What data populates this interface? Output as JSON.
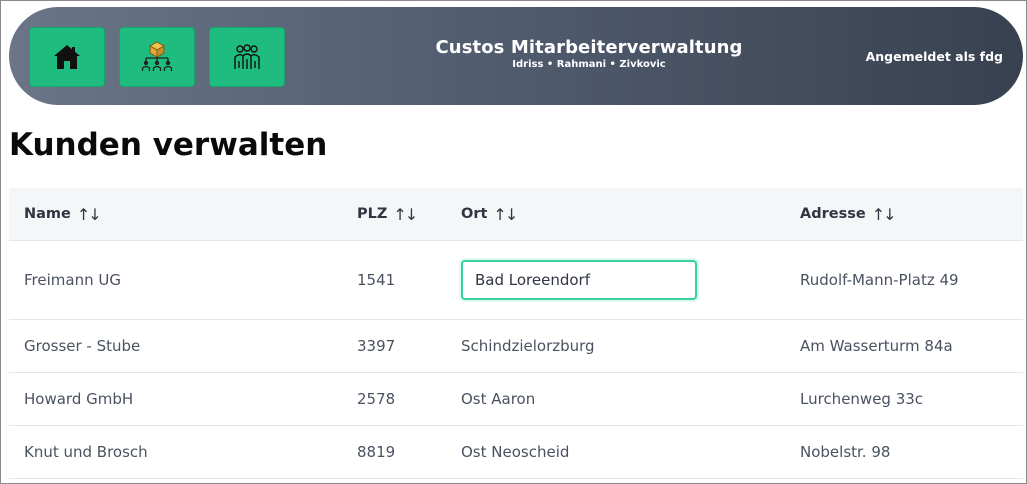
{
  "app": {
    "title": "Custos Mitarbeiterverwaltung",
    "subtitle": "Idriss • Rahmani • Zivkovic",
    "login_status": "Angemeldet als fdg"
  },
  "nav": [
    {
      "icon": "home-icon"
    },
    {
      "icon": "customers-network-icon"
    },
    {
      "icon": "employees-group-icon"
    }
  ],
  "page": {
    "heading": "Kunden verwalten"
  },
  "table": {
    "columns": [
      "Name",
      "PLZ",
      "Ort",
      "Adresse"
    ],
    "sort_glyph": "↑↓",
    "rows": [
      {
        "name": "Freimann UG",
        "plz": "1541",
        "ort": "Bad Loreendorf",
        "adresse": "Rudolf-Mann-Platz 49"
      },
      {
        "name": "Grosser - Stube",
        "plz": "3397",
        "ort": "Schindzielorzburg",
        "adresse": "Am Wasserturm 84a"
      },
      {
        "name": "Howard GmbH",
        "plz": "2578",
        "ort": "Ost Aaron",
        "adresse": "Lurchenweg 33c"
      },
      {
        "name": "Knut und Brosch",
        "plz": "8819",
        "ort": "Ost Neoscheid",
        "adresse": "Nobelstr. 98"
      }
    ],
    "editing": {
      "row": 0,
      "column": "ort"
    }
  },
  "colors": {
    "accent_button": "#1fbc7f",
    "header_gradient_start": "#6b7588",
    "header_gradient_end": "#384150",
    "edit_border": "#34d399"
  }
}
